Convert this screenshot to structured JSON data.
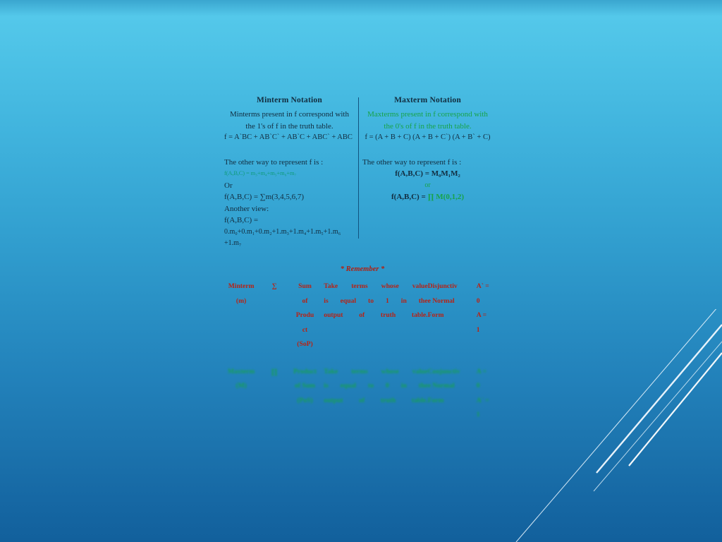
{
  "slide": {
    "background_top_color": "#54c8ea",
    "background_bottom_color": "#12609c"
  },
  "minterm_column": {
    "title": "Minterm Notation",
    "desc_line1": "Minterms present in f correspond with",
    "desc_line2": "the 1's of f in the truth table.",
    "equation": "f =  A`BC + AB`C` + AB`C + ABC` + ABC",
    "other_way_label": "The other way to represent f is :",
    "sum_of_minterms": "f(A,B,C) = m₃+m₄+m₅+m₆+m₇",
    "or_label": "Or",
    "sigma_form": "f(A,B,C) = ∑m(3,4,5,6,7)",
    "another_view_label": "Another view:",
    "another_view_fn": "f(A,B,C) =",
    "another_view_line1": "0.m₀+0.m₁+0.m₂+1.m₃+1.m₄+1.m₅+1.m₆",
    "another_view_line2": "+1.m₇"
  },
  "maxterm_column": {
    "title": "Maxterm Notation",
    "desc_line1": "Maxterms present in f correspond with",
    "desc_line2": "the 0's of f in the truth table.",
    "equation": "f = (A + B + C) (A + B + C`) (A + B` + C)",
    "other_way_label": "The other way to represent f is :",
    "product_of_maxterms": "f(A,B,C) = M₀M₁M₂",
    "or_label": "or",
    "pi_form_prefix": "f(A,B,C) =",
    "pi_form_value": "∏ M(0,1,2)"
  },
  "remember": {
    "title": "* Remember *",
    "rows": [
      {
        "term": "Minterm",
        "term_line2": "(m)",
        "symbol": "∑",
        "operation_line1": "Sum",
        "operation_line2": "of",
        "operation_line3": "Produ",
        "operation_line4": "ct",
        "operation_line5": "(SoP)",
        "rule_line1": "Take terms whose value",
        "rule_line2": "is equal to 1 in the",
        "rule_line3": "output of truth table.",
        "form_line1": "Disjunctiv",
        "form_line2": "e Normal",
        "form_line3": "Form",
        "convention_line1": "A` =",
        "convention_line2": "0",
        "convention_line3": "A =",
        "convention_line4": "1"
      },
      {
        "term": "Maxterm",
        "term_line2": "(M)",
        "symbol": "∏",
        "operation_line1": "Product",
        "operation_line2": "of Sum",
        "operation_line3": "(PoS)",
        "operation_line4": "",
        "operation_line5": "",
        "rule_line1": "Take terms whose value",
        "rule_line2": "is equal to 0 in the",
        "rule_line3": "output of truth table.",
        "form_line1": "Conjunctiv",
        "form_line2": "e Normal",
        "form_line3": "Form",
        "convention_line1": "A =",
        "convention_line2": "0",
        "convention_line3": "A` =",
        "convention_line4": "1"
      }
    ]
  }
}
